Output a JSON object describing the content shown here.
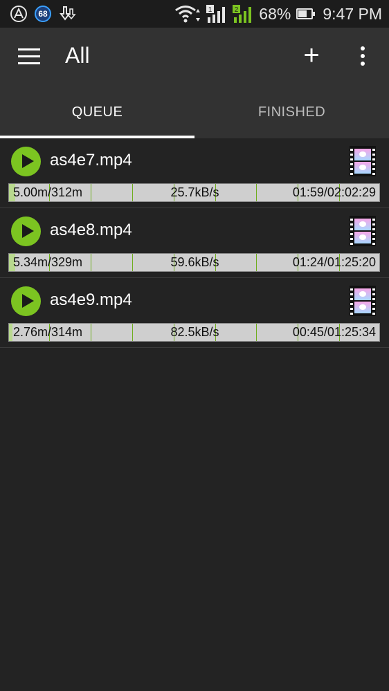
{
  "status_bar": {
    "badge": "68",
    "battery": "68%",
    "battery_level": 0.68,
    "time": "9:47 PM",
    "sim1": "1",
    "sim2": "2"
  },
  "app_bar": {
    "title": "All",
    "add_label": "+"
  },
  "tabs": [
    {
      "label": "QUEUE",
      "active": true
    },
    {
      "label": "FINISHED",
      "active": false
    }
  ],
  "downloads": [
    {
      "name": "as4e7.mp4",
      "size": "5.00m/312m",
      "speed": "25.7kB/s",
      "time": "01:59/02:02:29",
      "progress": 0.016
    },
    {
      "name": "as4e8.mp4",
      "size": "5.34m/329m",
      "speed": "59.6kB/s",
      "time": "01:24/01:25:20",
      "progress": 0.016
    },
    {
      "name": "as4e9.mp4",
      "size": "2.76m/314m",
      "speed": "82.5kB/s",
      "time": "00:45/01:25:34",
      "progress": 0.009
    }
  ],
  "colors": {
    "accent": "#7cc421",
    "background": "#232323",
    "toolbar": "#323232"
  }
}
